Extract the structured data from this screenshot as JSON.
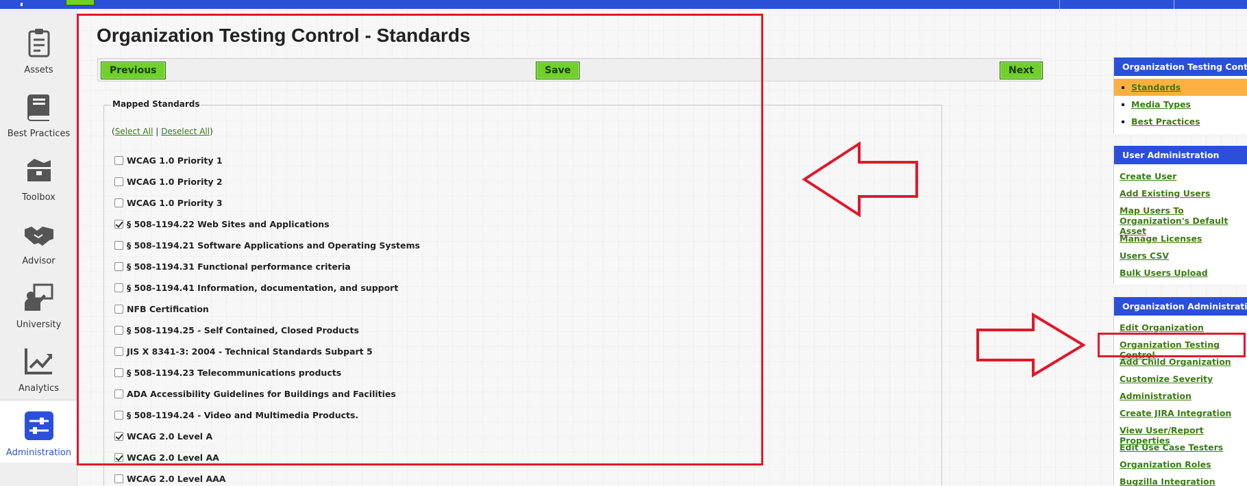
{
  "page_title": "Organization Testing Control - Standards",
  "toolbar": {
    "previous": "Previous",
    "save": "Save",
    "next": "Next"
  },
  "left_nav": [
    {
      "label": "Assets",
      "icon": "clipboard-icon"
    },
    {
      "label": "Best Practices",
      "icon": "book-icon"
    },
    {
      "label": "Toolbox",
      "icon": "toolbox-icon"
    },
    {
      "label": "Advisor",
      "icon": "handshake-icon"
    },
    {
      "label": "University",
      "icon": "teacher-icon"
    },
    {
      "label": "Analytics",
      "icon": "chart-icon"
    },
    {
      "label": "Administration",
      "icon": "sliders-icon",
      "active": true
    }
  ],
  "mapped_standards": {
    "legend": "Mapped Standards",
    "select_all": "Select All",
    "separator": "|",
    "deselect_all": "Deselect All",
    "open_paren": "(",
    "close_paren": ")",
    "items": [
      {
        "label": "WCAG 1.0 Priority 1",
        "checked": false
      },
      {
        "label": "WCAG 1.0 Priority 2",
        "checked": false
      },
      {
        "label": "WCAG 1.0 Priority 3",
        "checked": false
      },
      {
        "label": "§ 508-1194.22 Web Sites and Applications",
        "checked": true
      },
      {
        "label": "§ 508-1194.21 Software Applications and Operating Systems",
        "checked": false
      },
      {
        "label": "§ 508-1194.31 Functional performance criteria",
        "checked": false
      },
      {
        "label": "§ 508-1194.41 Information, documentation, and support",
        "checked": false
      },
      {
        "label": "NFB Certification",
        "checked": false
      },
      {
        "label": "§ 508-1194.25 - Self Contained, Closed Products",
        "checked": false
      },
      {
        "label": "JIS X 8341-3: 2004 - Technical Standards Subpart 5",
        "checked": false
      },
      {
        "label": "§ 508-1194.23 Telecommunications products",
        "checked": false
      },
      {
        "label": "ADA Accessibility Guidelines for Buildings and Facilities",
        "checked": false
      },
      {
        "label": "§ 508-1194.24 - Video and Multimedia Products.",
        "checked": false
      },
      {
        "label": "WCAG 2.0 Level A",
        "checked": true
      },
      {
        "label": "WCAG 2.0 Level AA",
        "checked": true
      },
      {
        "label": "WCAG 2.0 Level AAA",
        "checked": false
      }
    ]
  },
  "right_panel": {
    "testing_control": {
      "title": "Organization Testing Control",
      "items": [
        "Standards",
        "Media Types",
        "Best Practices"
      ],
      "active": "Standards"
    },
    "user_admin": {
      "title": "User Administration",
      "items": [
        "Create User",
        "Add Existing Users",
        "Map Users To Organization's Default Asset",
        "Manage Licenses",
        "Users CSV",
        "Bulk Users Upload"
      ]
    },
    "org_admin": {
      "title": "Organization Administration",
      "items": [
        "Edit Organization",
        "Organization Testing Control",
        "Add Child Organization",
        "Customize Severity",
        "Administration",
        "Create JIRA Integration",
        "View User/Report Properties",
        "Edit Use Case Testers",
        "Organization Roles",
        "Bugzilla Integration"
      ]
    }
  },
  "colors": {
    "brand_blue": "#2b50d8",
    "button_green": "#6fd12a",
    "link_green": "#3c7c14",
    "active_orange": "#fbb040",
    "annotation_red": "#e3162a"
  }
}
